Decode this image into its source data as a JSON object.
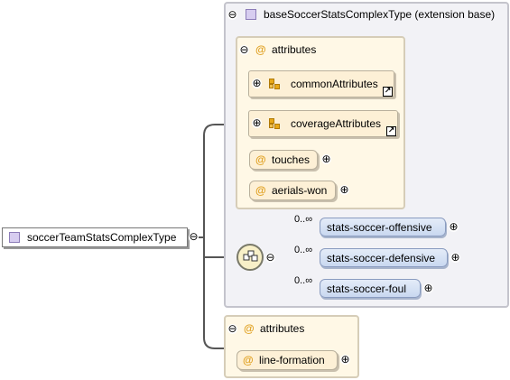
{
  "root": {
    "name": "soccerTeamStatsComplexType"
  },
  "base": {
    "label": "baseSoccerStatsComplexType (extension base)",
    "attributes_label": "attributes",
    "attribute_groups": [
      {
        "name": "commonAttributes"
      },
      {
        "name": "coverageAttributes"
      }
    ],
    "attributes": [
      {
        "name": "touches"
      },
      {
        "name": "aerials-won"
      }
    ],
    "sequence": {
      "elements": [
        {
          "cardinality": "0..∞",
          "name": "stats-soccer-offensive"
        },
        {
          "cardinality": "0..∞",
          "name": "stats-soccer-defensive"
        },
        {
          "cardinality": "0..∞",
          "name": "stats-soccer-foul"
        }
      ]
    }
  },
  "own_attributes": {
    "label": "attributes",
    "items": [
      {
        "name": "line-formation"
      }
    ]
  },
  "icons": {
    "collapse": "⊖",
    "expand": "⊕",
    "attribute": "@",
    "link": "↗",
    "complex-type": "purple-square-icon",
    "attribute-group": "attribute-group-icon",
    "sequence": "sequence-icon"
  },
  "colors": {
    "attribute_at": "#e0a020",
    "element_box": "#c9d8f0",
    "attribute_box": "#fdf0d6",
    "complex_type": "#d7cdf0"
  }
}
